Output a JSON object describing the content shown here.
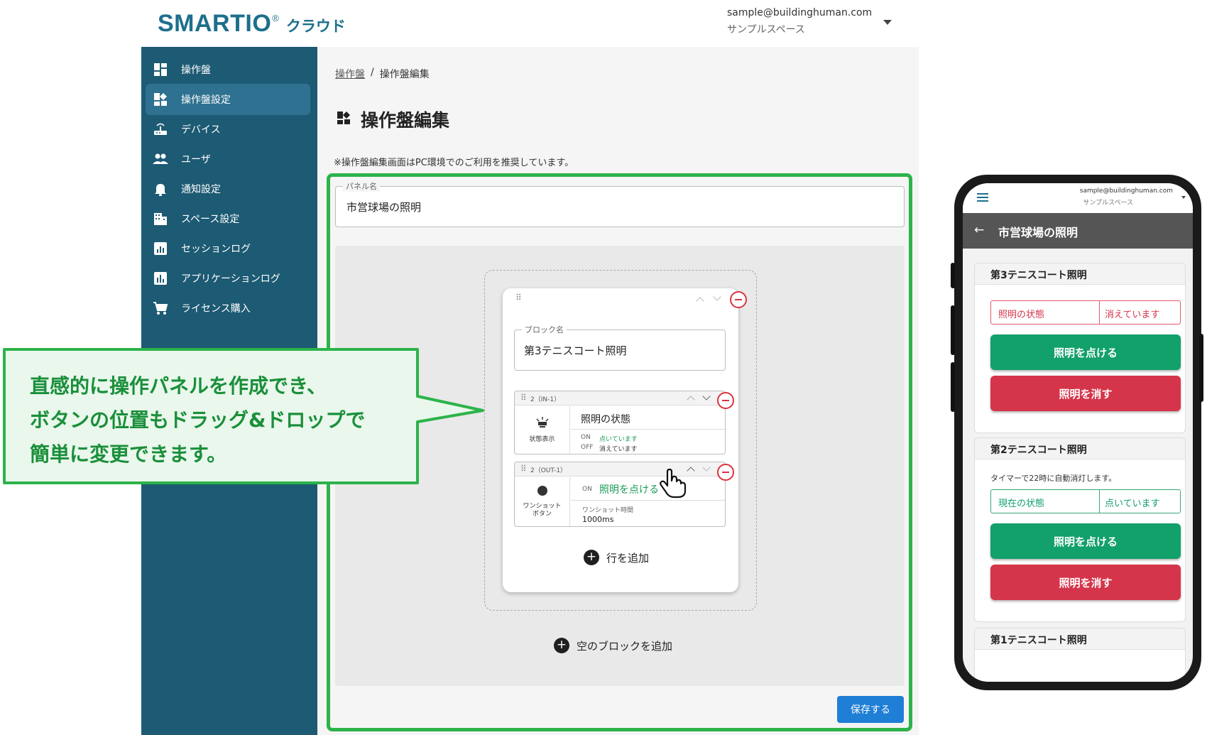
{
  "header": {
    "logo_word": "SMARTIO",
    "logo_reg": "®",
    "logo_sub": "クラウド",
    "account_email": "sample@buildinghuman.com",
    "account_space": "サンプルスペース"
  },
  "sidebar": {
    "items": [
      {
        "label": "操作盤",
        "icon": "dashboard-icon"
      },
      {
        "label": "操作盤設定",
        "icon": "dashboard-settings-icon",
        "active": true
      },
      {
        "label": "デバイス",
        "icon": "router-icon"
      },
      {
        "label": "ユーザ",
        "icon": "people-icon"
      },
      {
        "label": "通知設定",
        "icon": "bell-icon"
      },
      {
        "label": "スペース設定",
        "icon": "building-icon"
      },
      {
        "label": "セッションログ",
        "icon": "chart-box-icon"
      },
      {
        "label": "アプリケーションログ",
        "icon": "bar-chart-icon"
      },
      {
        "label": "ライセンス購入",
        "icon": "cart-icon"
      }
    ]
  },
  "main": {
    "breadcrumb_parent": "操作盤",
    "breadcrumb_sep": "/",
    "breadcrumb_current": "操作盤編集",
    "title": "操作盤編集",
    "notice": "※操作盤編集画面はPC環境でのご利用を推奨しています。",
    "panel_name_label": "パネル名",
    "panel_name_value": "市営球場の照明",
    "block_name_label": "ブロック名",
    "block_name_value": "第3テニスコート照明",
    "row1": {
      "head": "2（IN-1）",
      "left_label": "状態表示",
      "title": "照明の状態",
      "on_label": "ON",
      "on_value": "点いています",
      "off_label": "OFF",
      "off_value": "消えています"
    },
    "row2": {
      "head": "2（OUT-1）",
      "left_label": "ワンショット\nボタン",
      "on_label": "ON",
      "on_value": "照明を点ける",
      "time_label": "ワンショット時間",
      "time_value": "1000ms"
    },
    "add_row_label": "行を追加",
    "add_block_label": "空のブロックを追加",
    "save_label": "保存する"
  },
  "callout": {
    "line1": "直感的に操作パネルを作成でき、",
    "line2": "ボタンの位置もドラッグ&ドロップで",
    "line3": "簡単に変更できます。"
  },
  "phone": {
    "email": "sample@buildinghuman.com",
    "space": "サンプルスペース",
    "title": "市営球場の照明",
    "cards": [
      {
        "title": "第3テニスコート照明",
        "status_label": "照明の状態",
        "status_value": "消えています",
        "on_btn": "照明を点ける",
        "off_btn": "照明を消す"
      },
      {
        "title": "第2テニスコート照明",
        "note": "タイマーで22時に自動消灯します。",
        "status_label": "現在の状態",
        "status_value": "点いています",
        "on_btn": "照明を点ける",
        "off_btn": "照明を消す"
      },
      {
        "title": "第1テニスコート照明"
      }
    ]
  },
  "colors": {
    "sidebar": "#1d5a73",
    "sidebar_active": "#2f7190",
    "brand": "#1d6f8c",
    "highlight_green": "#2db34a",
    "on_green": "#12a06b",
    "off_red": "#d5354a",
    "save_blue": "#1f7ed6"
  }
}
